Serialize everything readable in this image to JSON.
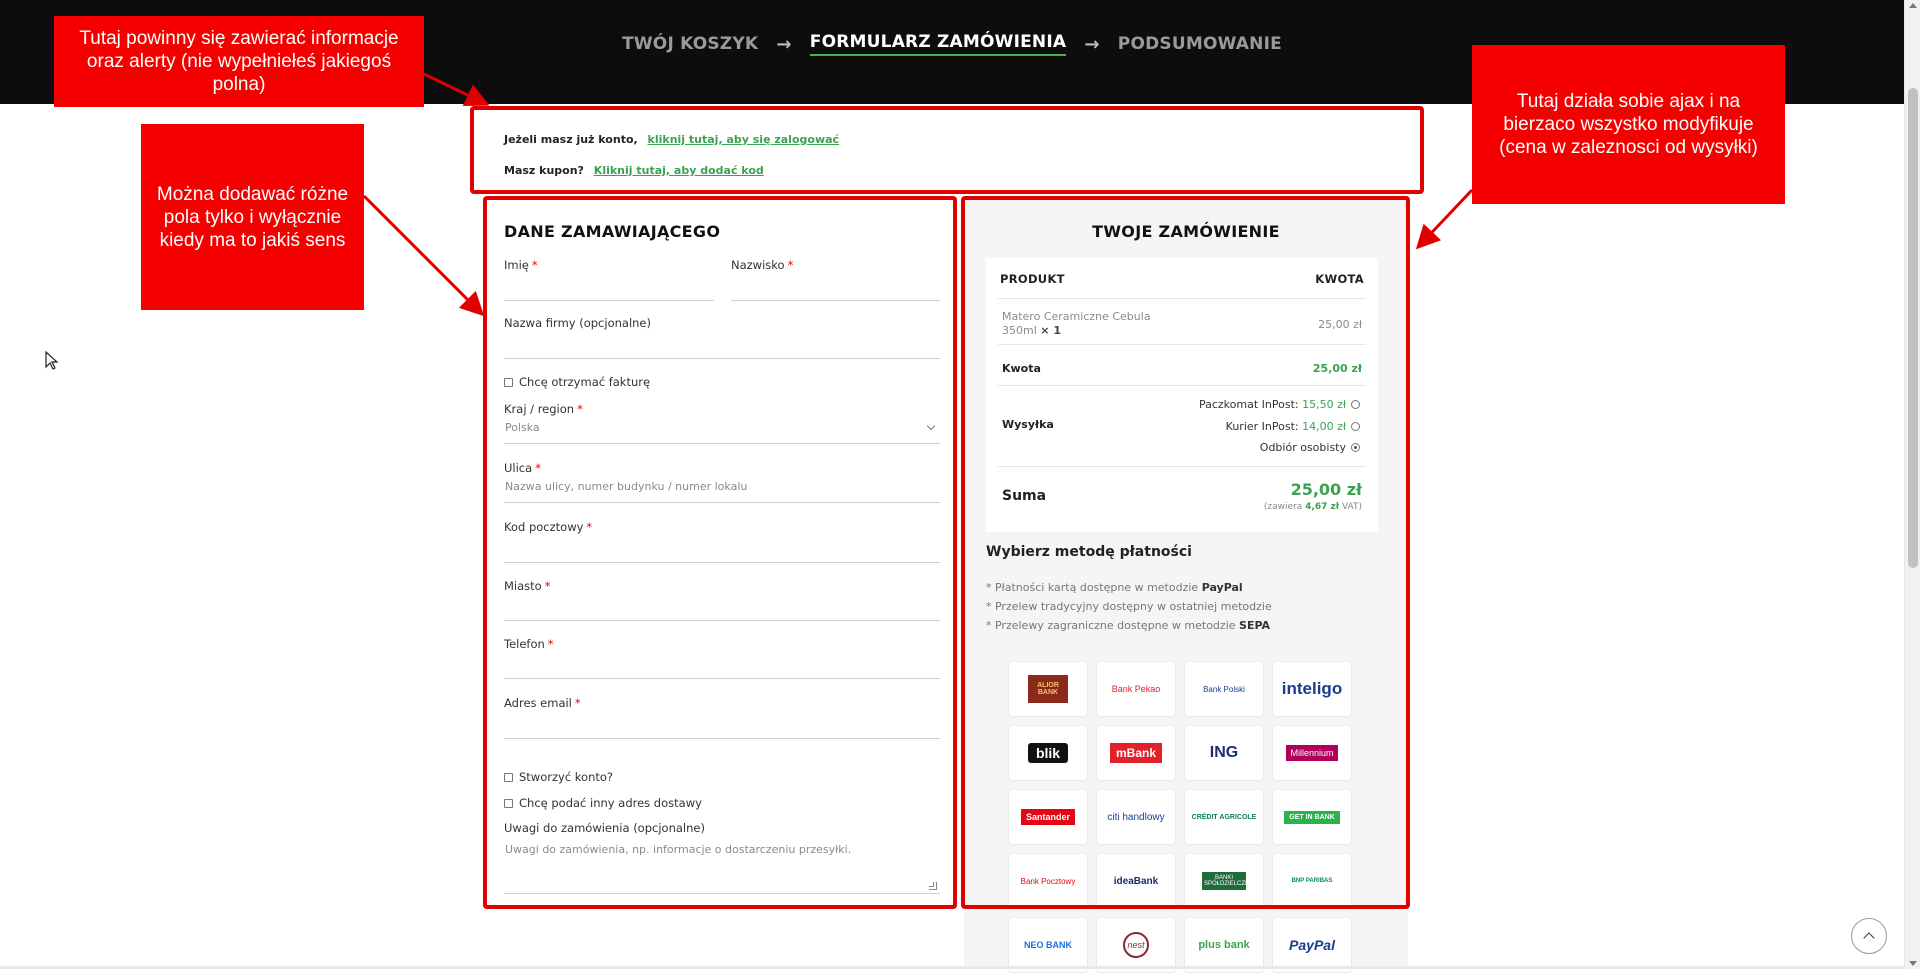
{
  "header": {
    "steps": [
      "TWÓJ KOSZYK",
      "FORMULARZ ZAMÓWIENIA",
      "PODSUMOWANIE"
    ],
    "arrow": "→",
    "active_step": "FORMULARZ ZAMÓWIENIA"
  },
  "annotations": {
    "top_left": "Tutaj powinny się zawierać informacje oraz alerty (nie wypełniełeś jakiegoś polna)",
    "left": "Można dodawać różne pola tylko i wyłącznie kiedy ma to jakiś sens",
    "right": "Tutaj działa sobie ajax i na bierzaco wszystko modyfikuje (cena w zaleznosci od wysyłki)"
  },
  "info": {
    "login_prompt": "Jeżeli masz już konto,",
    "login_link": "kliknij tutaj, aby się zalogować",
    "coupon_prompt": "Masz kupon?",
    "coupon_link": "Kliknij tutaj, aby dodać kod"
  },
  "billing": {
    "title": "DANE ZAMAWIAJĄCEGO",
    "required_mark": "*",
    "first_name": "Imię",
    "last_name": "Nazwisko",
    "company": "Nazwa firmy (opcjonalne)",
    "invoice_checkbox": "Chcę otrzymać fakturę",
    "country_label": "Kraj / region",
    "country_value": "Polska",
    "street_label": "Ulica",
    "street_placeholder": "Nazwa ulicy, numer budynku / numer lokalu",
    "postcode_label": "Kod pocztowy",
    "city_label": "Miasto",
    "phone_label": "Telefon",
    "email_label": "Adres email",
    "create_account": "Stworzyć konto?",
    "other_address": "Chcę podać inny adres dostawy",
    "notes_label": "Uwagi do zamówienia (opcjonalne)",
    "notes_placeholder": "Uwagi do zamówienia, np. informacje o dostarczeniu przesyłki."
  },
  "order": {
    "title": "TWOJE ZAMÓWIENIE",
    "col_product": "PRODUKT",
    "col_amount": "KWOTA",
    "product_name": "Matero Ceramiczne Cebula",
    "product_size": "350ml",
    "product_qty": "× 1",
    "product_price": "25,00 zł",
    "subtotal_label": "Kwota",
    "subtotal_value": "25,00 zł",
    "shipping_label": "Wysyłka",
    "shipping_options": [
      {
        "name": "Paczkomat InPost:",
        "price": "15,50 zł",
        "selected": false
      },
      {
        "name": "Kurier InPost:",
        "price": "14,00 zł",
        "selected": false
      },
      {
        "name": "Odbiór osobisty",
        "price": "",
        "selected": true
      }
    ],
    "total_label": "Suma",
    "total_value": "25,00 zł",
    "vat_prefix": "(zawiera",
    "vat_value": "4,67 zł",
    "vat_suffix": "VAT)"
  },
  "payment": {
    "title": "Wybierz metodę płatności",
    "notes": [
      {
        "text": "* Płatności kartą dostępne w metodzie",
        "bold": "PayPal"
      },
      {
        "text": "* Przelew tradycyjny dostępny w ostatniej metodzie",
        "bold": ""
      },
      {
        "text": "* Przelewy zagraniczne dostępne w metodzie",
        "bold": "SEPA"
      }
    ],
    "banks": [
      "ALIOR BANK",
      "Bank Pekao",
      "Bank Polski",
      "inteligo",
      "blik",
      "mBank",
      "ING",
      "Millennium",
      "Santander",
      "citi handlowy",
      "CRÉDIT AGRICOLE",
      "GET IN BANK",
      "Bank Pocztowy",
      "ideaBank",
      "BANKI SPÓŁDZIELCZE",
      "BNP PARIBAS",
      "NEO BANK",
      "nest",
      "plus bank",
      "PayPal"
    ]
  },
  "colors": {
    "accent_green": "#3aa351",
    "annotation_red": "#f40000",
    "header_bg": "#0d0d0d"
  }
}
